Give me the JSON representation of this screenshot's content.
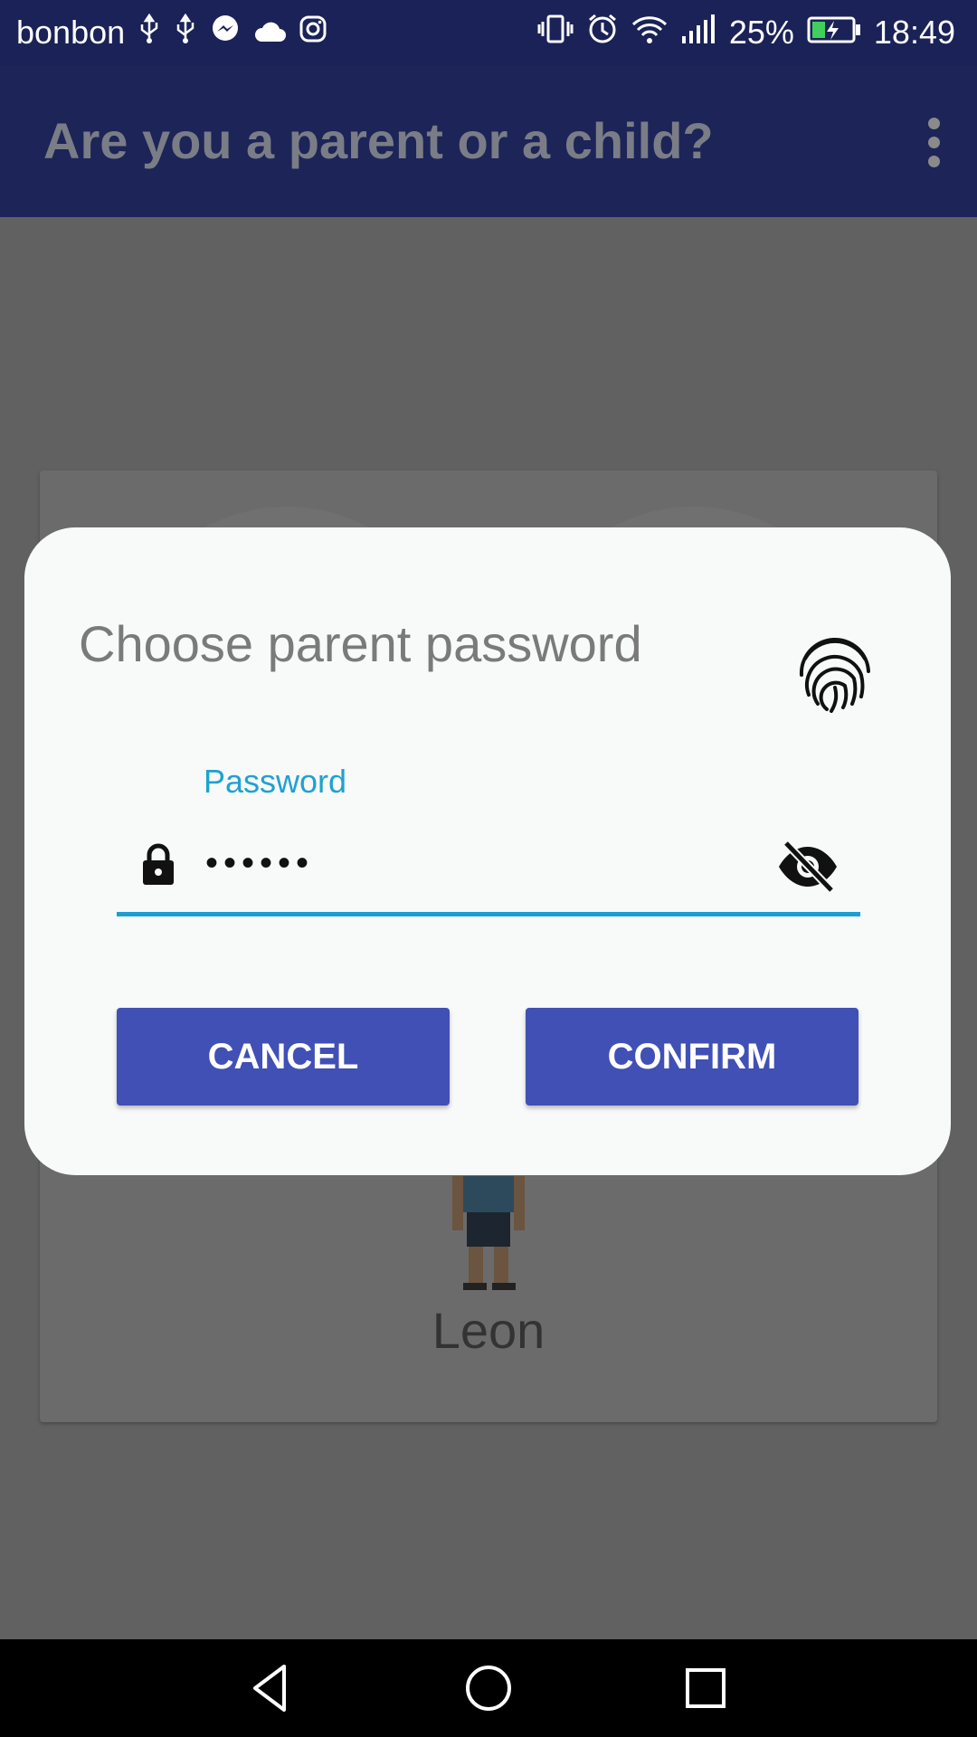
{
  "status_bar": {
    "carrier": "bonbon",
    "battery_percent": "25%",
    "time": "18:49",
    "left_icons": [
      "usb-icon",
      "usb-icon",
      "messenger-icon",
      "cloud-icon",
      "instagram-icon"
    ],
    "right_icons": [
      "vibrate-icon",
      "alarm-icon",
      "wifi-icon",
      "signal-icon",
      "battery-charging-icon"
    ]
  },
  "app_bar": {
    "title": "Are you a parent or a child?",
    "menu_icon": "overflow-menu-icon"
  },
  "background": {
    "child_name": "Leon"
  },
  "dialog": {
    "title": "Choose parent password",
    "fingerprint_icon": "fingerprint-icon",
    "password": {
      "label": "Password",
      "value": "••••••",
      "leading_icon": "lock-icon",
      "trailing_icon": "visibility-off-icon"
    },
    "cancel_label": "CANCEL",
    "confirm_label": "CONFIRM"
  },
  "nav_bar": {
    "icons": [
      "back-icon",
      "home-icon",
      "recents-icon"
    ]
  },
  "colors": {
    "app_bar": "#1c2458",
    "accent": "#1fa2cf",
    "button": "#4050b5",
    "dialog_bg": "#f8f9f9",
    "scrim": "#616161"
  }
}
